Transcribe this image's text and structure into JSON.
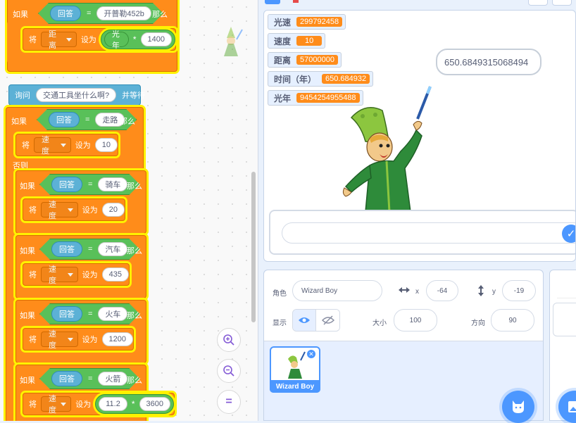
{
  "blocks": {
    "if1": {
      "if": "如果",
      "var": "回答",
      "eq": "=",
      "value": "开普勒452b",
      "then": "那么"
    },
    "set1": {
      "set": "将",
      "var": "距离",
      "to": "设为",
      "op_var": "光年",
      "op_sign": "*",
      "op_value": "1400"
    },
    "ask": {
      "label": "询问",
      "question": "交通工具坐什么啊?",
      "wait": "并等待"
    },
    "if2": {
      "if": "如果",
      "var": "回答",
      "eq": "=",
      "value": "走路",
      "then": "那么"
    },
    "set2": {
      "set": "将",
      "var": "速度",
      "to": "设为",
      "value": "10"
    },
    "else": "否则",
    "if3": {
      "if": "如果",
      "var": "回答",
      "eq": "=",
      "value": "骑车",
      "then": "那么"
    },
    "set3": {
      "set": "将",
      "var": "速度",
      "to": "设为",
      "value": "20"
    },
    "if4": {
      "if": "如果",
      "var": "回答",
      "eq": "=",
      "value": "汽车",
      "then": "那么"
    },
    "set4": {
      "set": "将",
      "var": "速度",
      "to": "设为",
      "value": "435"
    },
    "if5": {
      "if": "如果",
      "var": "回答",
      "eq": "=",
      "value": "火车",
      "then": "那么"
    },
    "set5": {
      "set": "将",
      "var": "速度",
      "to": "设为",
      "value": "1200"
    },
    "if6": {
      "if": "如果",
      "var": "回答",
      "eq": "=",
      "value": "火箭",
      "then": "那么"
    },
    "set6": {
      "set": "将",
      "var": "速度",
      "to": "设为",
      "op_value1": "11.2",
      "op_sign": "*",
      "op_value2": "3600"
    }
  },
  "zoom": {
    "in": "+",
    "out": "−",
    "reset": "="
  },
  "stage": {
    "monitors": [
      {
        "label": "光速",
        "value": "299792458"
      },
      {
        "label": "速度",
        "value": "10"
      },
      {
        "label": "距离",
        "value": "57000000"
      },
      {
        "label": "时间（年）",
        "value": "650.684932"
      },
      {
        "label": "光年",
        "value": "9454254955488"
      }
    ],
    "speech": "650.6849315068494",
    "ask_check": "✓"
  },
  "sprite_info": {
    "sprite_label": "角色",
    "sprite_name": "Wizard Boy",
    "x_label": "x",
    "x_value": "-64",
    "y_label": "y",
    "y_value": "-19",
    "show_label": "显示",
    "size_label": "大小",
    "size_value": "100",
    "direction_label": "方向",
    "direction_value": "90"
  },
  "sprites": [
    {
      "name": "Wizard Boy"
    }
  ],
  "icons": {
    "add_sprite": "cat-icon",
    "add_backdrop": "image-icon",
    "delete": "close-icon",
    "show": "eye-icon",
    "hide": "eye-slash-icon"
  },
  "colors": {
    "control": "#ff8c1a",
    "operator": "#59c059",
    "sensing": "#5cb1d6",
    "highlight": "#fff200",
    "accent": "#4c97ff"
  }
}
